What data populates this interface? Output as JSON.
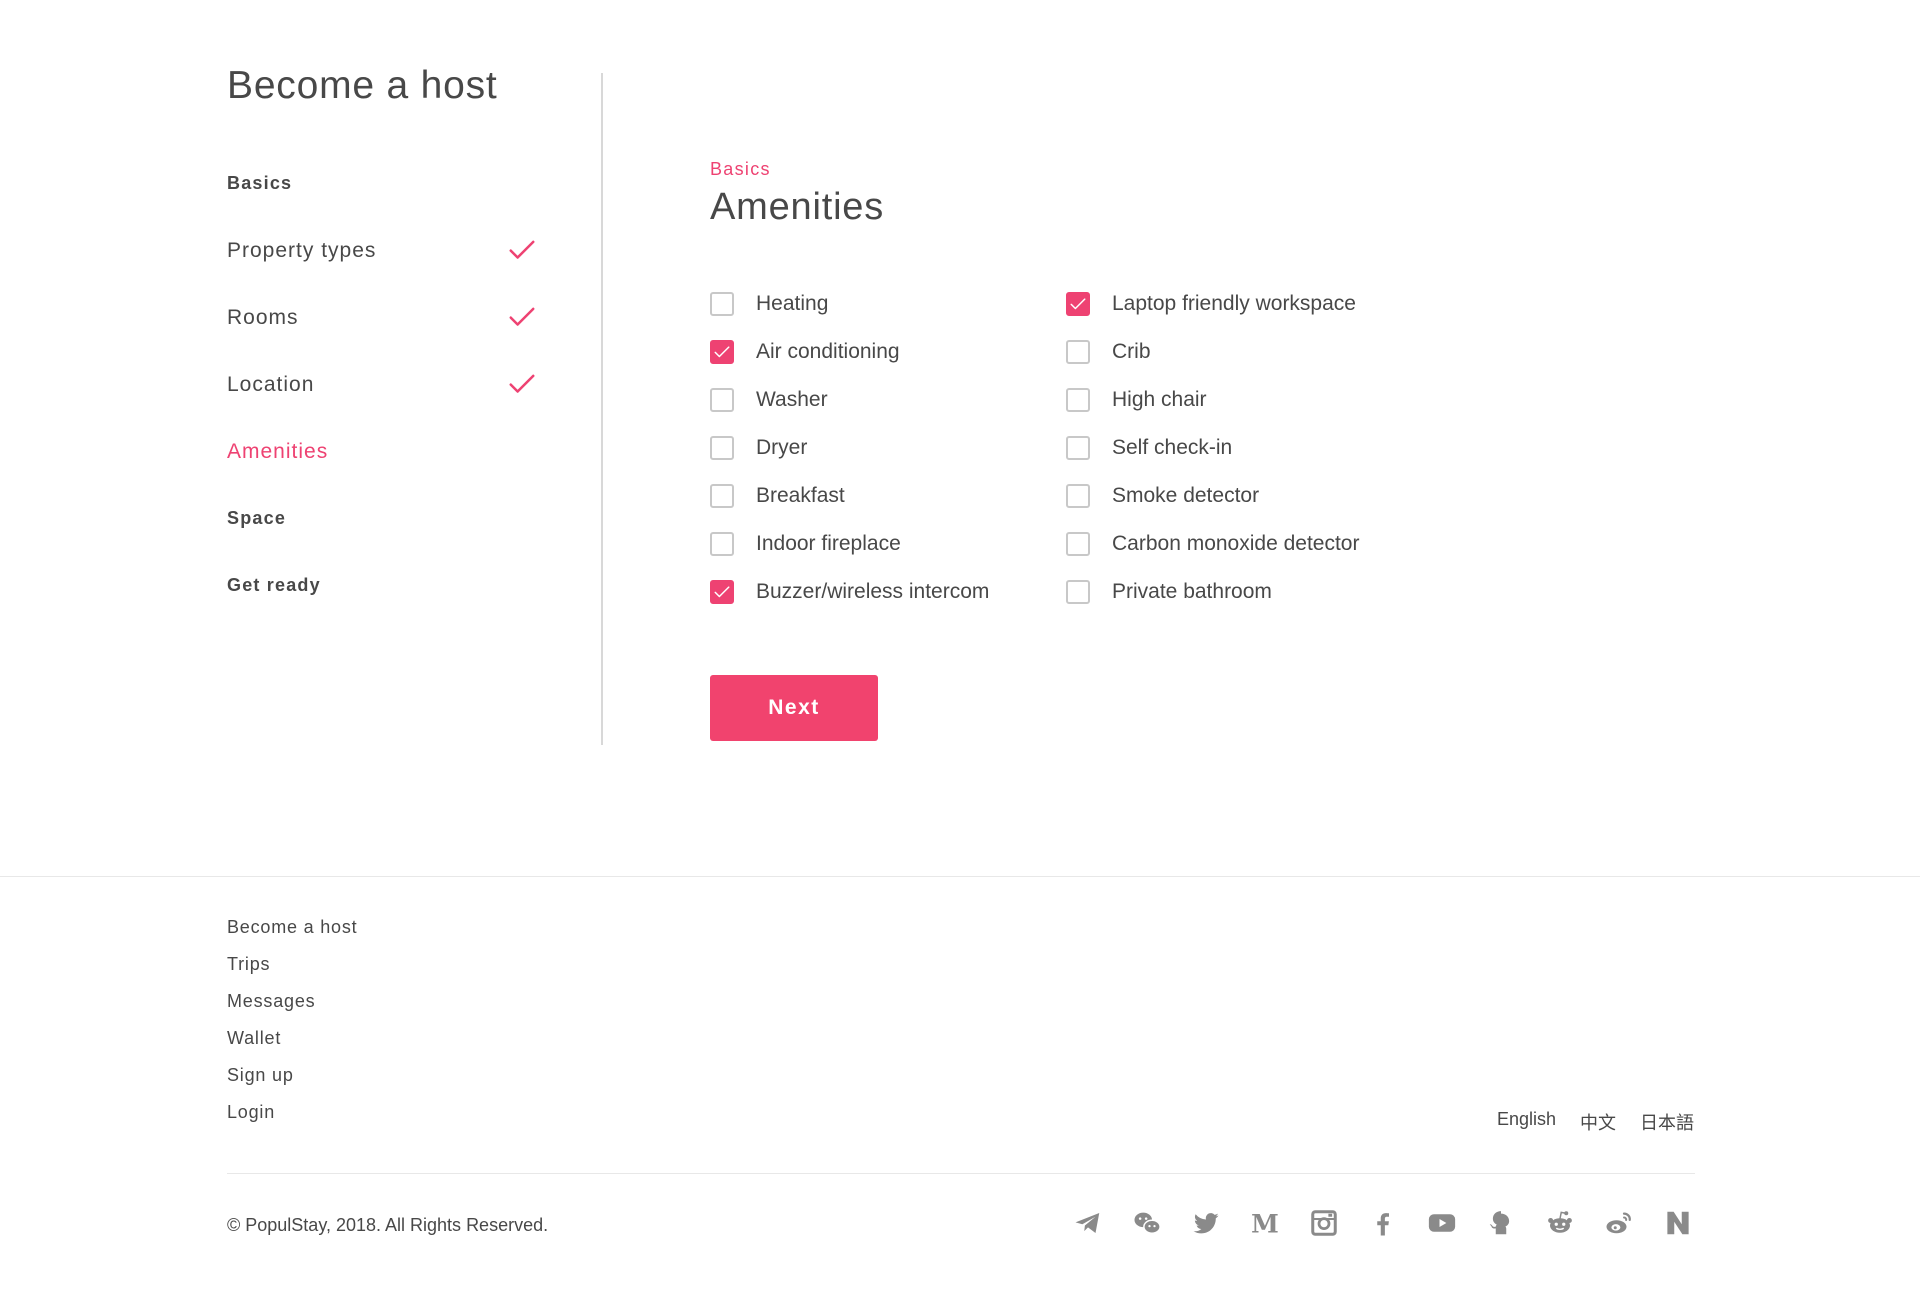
{
  "colors": {
    "accent": "#ee4272",
    "text": "#484848",
    "muted": "#888888",
    "border": "#c8c8c8"
  },
  "sidebar": {
    "title": "Become a host",
    "items": [
      {
        "label": "Basics",
        "kind": "section",
        "done": false,
        "active": false
      },
      {
        "label": "Property types",
        "kind": "step",
        "done": true,
        "active": false
      },
      {
        "label": "Rooms",
        "kind": "step",
        "done": true,
        "active": false
      },
      {
        "label": "Location",
        "kind": "step",
        "done": true,
        "active": false
      },
      {
        "label": "Amenities",
        "kind": "step",
        "done": false,
        "active": true
      },
      {
        "label": "Space",
        "kind": "section",
        "done": false,
        "active": false
      },
      {
        "label": "Get ready",
        "kind": "section",
        "done": false,
        "active": false
      }
    ]
  },
  "main": {
    "eyebrow": "Basics",
    "title": "Amenities",
    "amenities_left": [
      {
        "label": "Heating",
        "checked": false
      },
      {
        "label": "Air conditioning",
        "checked": true
      },
      {
        "label": "Washer",
        "checked": false
      },
      {
        "label": "Dryer",
        "checked": false
      },
      {
        "label": "Breakfast",
        "checked": false
      },
      {
        "label": "Indoor fireplace",
        "checked": false
      },
      {
        "label": "Buzzer/wireless intercom",
        "checked": true
      }
    ],
    "amenities_right": [
      {
        "label": "Laptop friendly workspace",
        "checked": true
      },
      {
        "label": "Crib",
        "checked": false
      },
      {
        "label": "High chair",
        "checked": false
      },
      {
        "label": "Self check-in",
        "checked": false
      },
      {
        "label": "Smoke detector",
        "checked": false
      },
      {
        "label": "Carbon monoxide detector",
        "checked": false
      },
      {
        "label": "Private bathroom",
        "checked": false
      }
    ],
    "next_label": "Next"
  },
  "footer": {
    "links": [
      "Become a host",
      "Trips",
      "Messages",
      "Wallet",
      "Sign up",
      "Login"
    ],
    "languages": [
      "English",
      "中文",
      "日本語"
    ],
    "copyright": "© PopulStay, 2018. All Rights Reserved.",
    "socials": [
      "telegram-icon",
      "wechat-icon",
      "twitter-icon",
      "medium-icon",
      "instagram-icon",
      "facebook-icon",
      "youtube-icon",
      "github-icon",
      "reddit-icon",
      "weibo-icon",
      "n-icon"
    ]
  }
}
